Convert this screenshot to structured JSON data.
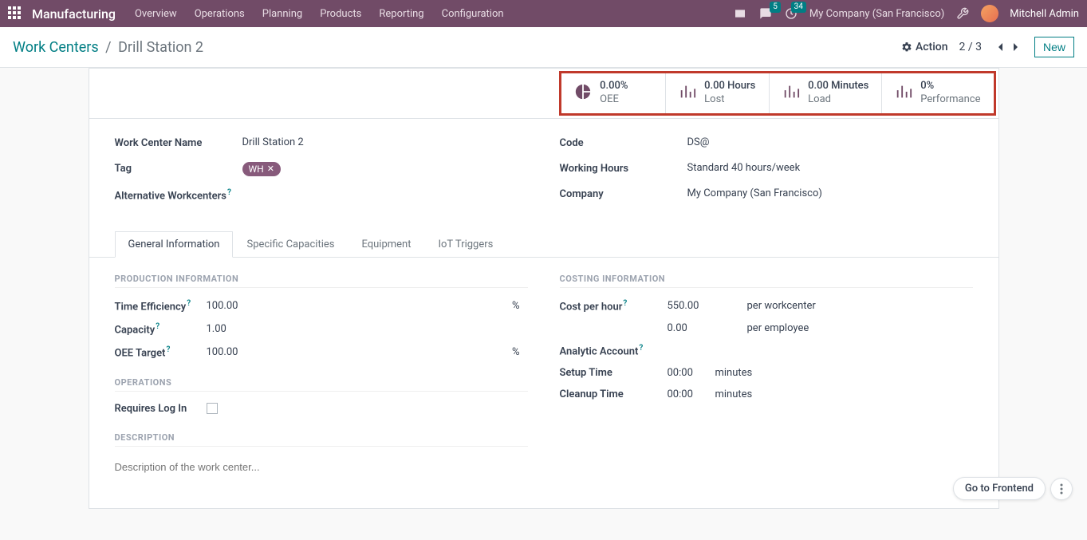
{
  "nav": {
    "brand": "Manufacturing",
    "links": [
      "Overview",
      "Operations",
      "Planning",
      "Products",
      "Reporting",
      "Configuration"
    ],
    "chat_badge": "5",
    "clock_badge": "34",
    "company": "My Company (San Francisco)",
    "user": "Mitchell Admin"
  },
  "controlbar": {
    "breadcrumb_root": "Work Centers",
    "breadcrumb_current": "Drill Station 2",
    "action_label": "Action",
    "pager": "2 / 3",
    "new_label": "New"
  },
  "stats": [
    {
      "value": "0.00%",
      "label": "OEE"
    },
    {
      "value": "0.00 Hours",
      "label": "Lost"
    },
    {
      "value": "0.00 Minutes",
      "label": "Load"
    },
    {
      "value": "0%",
      "label": "Performance"
    }
  ],
  "fields": {
    "left": {
      "name_label": "Work Center Name",
      "name_value": "Drill Station 2",
      "tag_label": "Tag",
      "tag_value": "WH",
      "alt_label": "Alternative Workcenters"
    },
    "right": {
      "code_label": "Code",
      "code_value": "DS@",
      "hours_label": "Working Hours",
      "hours_value": "Standard 40 hours/week",
      "company_label": "Company",
      "company_value": "My Company (San Francisco)"
    }
  },
  "tabs": [
    "General Information",
    "Specific Capacities",
    "Equipment",
    "IoT Triggers"
  ],
  "general": {
    "production_title": "PRODUCTION INFORMATION",
    "time_eff_label": "Time Efficiency",
    "time_eff_value": "100.00",
    "time_eff_unit": "%",
    "capacity_label": "Capacity",
    "capacity_value": "1.00",
    "oee_target_label": "OEE Target",
    "oee_target_value": "100.00",
    "oee_target_unit": "%",
    "operations_title": "OPERATIONS",
    "requires_login_label": "Requires Log In",
    "description_title": "DESCRIPTION",
    "description_placeholder": "Description of the work center...",
    "costing_title": "COSTING INFORMATION",
    "cost_hour_label": "Cost per hour",
    "cost_hour_value": "550.00",
    "cost_hour_unit": "per workcenter",
    "cost_emp_value": "0.00",
    "cost_emp_unit": "per employee",
    "analytic_label": "Analytic Account",
    "setup_label": "Setup Time",
    "setup_value": "00:00",
    "setup_unit": "minutes",
    "cleanup_label": "Cleanup Time",
    "cleanup_value": "00:00",
    "cleanup_unit": "minutes"
  },
  "floating": {
    "frontend": "Go to Frontend"
  }
}
